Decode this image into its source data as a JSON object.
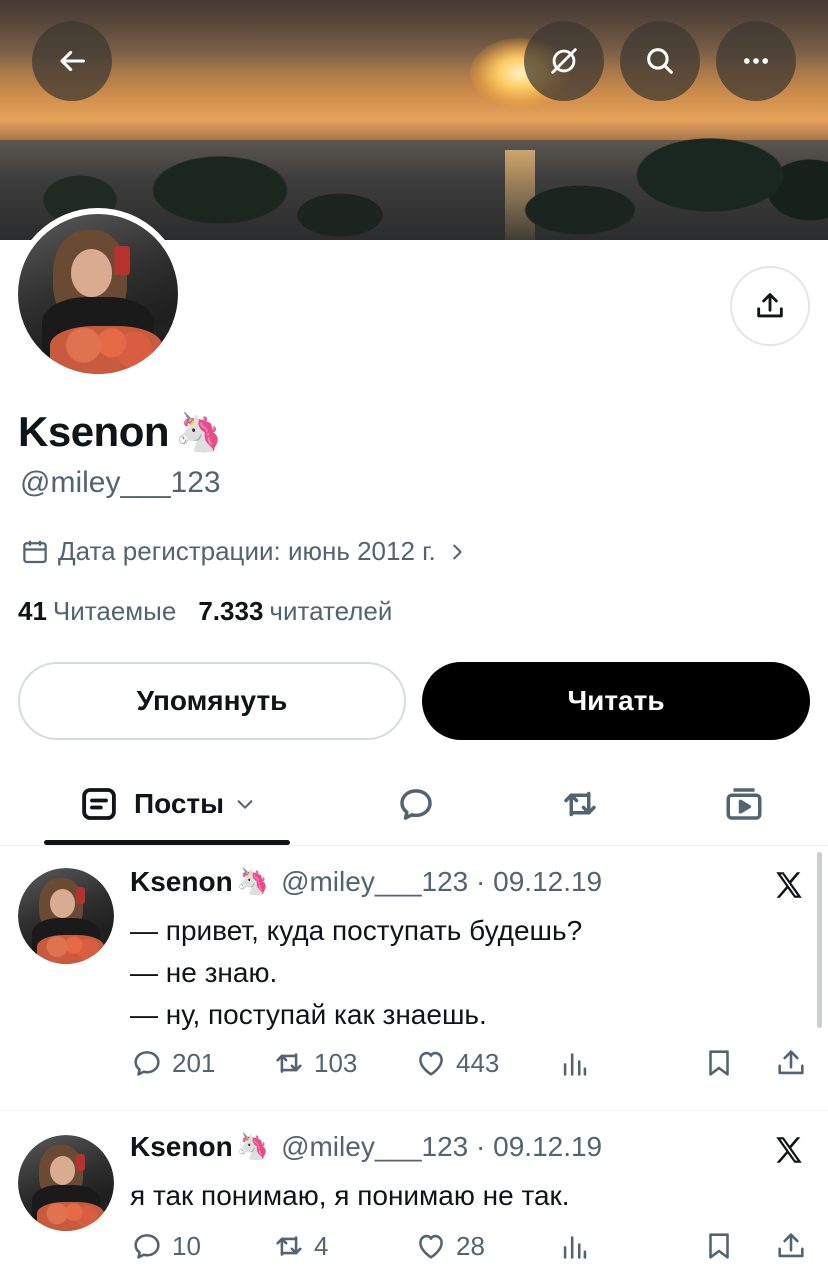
{
  "header": {
    "back_icon": "arrow-left-icon",
    "grok_icon": "grok-icon",
    "search_icon": "search-icon",
    "more_icon": "more-dots-icon"
  },
  "profile": {
    "display_name": "Ksenon",
    "name_emoji": "🦄",
    "handle": "@miley___123",
    "joined": "Дата регистрации: июнь 2012 г.",
    "following_count": "41",
    "following_label": "Читаемые",
    "followers_count": "7.333",
    "followers_label": "читателей"
  },
  "buttons": {
    "mention": "Упомянуть",
    "follow": "Читать"
  },
  "tabs": {
    "posts": "Посты"
  },
  "posts": [
    {
      "name": "Ksenon",
      "emoji": "🦄",
      "meta": "@miley___123 · 09.12.19",
      "text": "— привет, куда поступать будешь?\n— не знаю.\n— ну, поступай как знаешь.",
      "replies": "201",
      "reposts": "103",
      "likes": "443"
    },
    {
      "name": "Ksenon",
      "emoji": "🦄",
      "meta": "@miley___123 · 09.12.19",
      "text": "я так понимаю, я понимаю не так.",
      "replies": "10",
      "reposts": "4",
      "likes": "28"
    }
  ]
}
